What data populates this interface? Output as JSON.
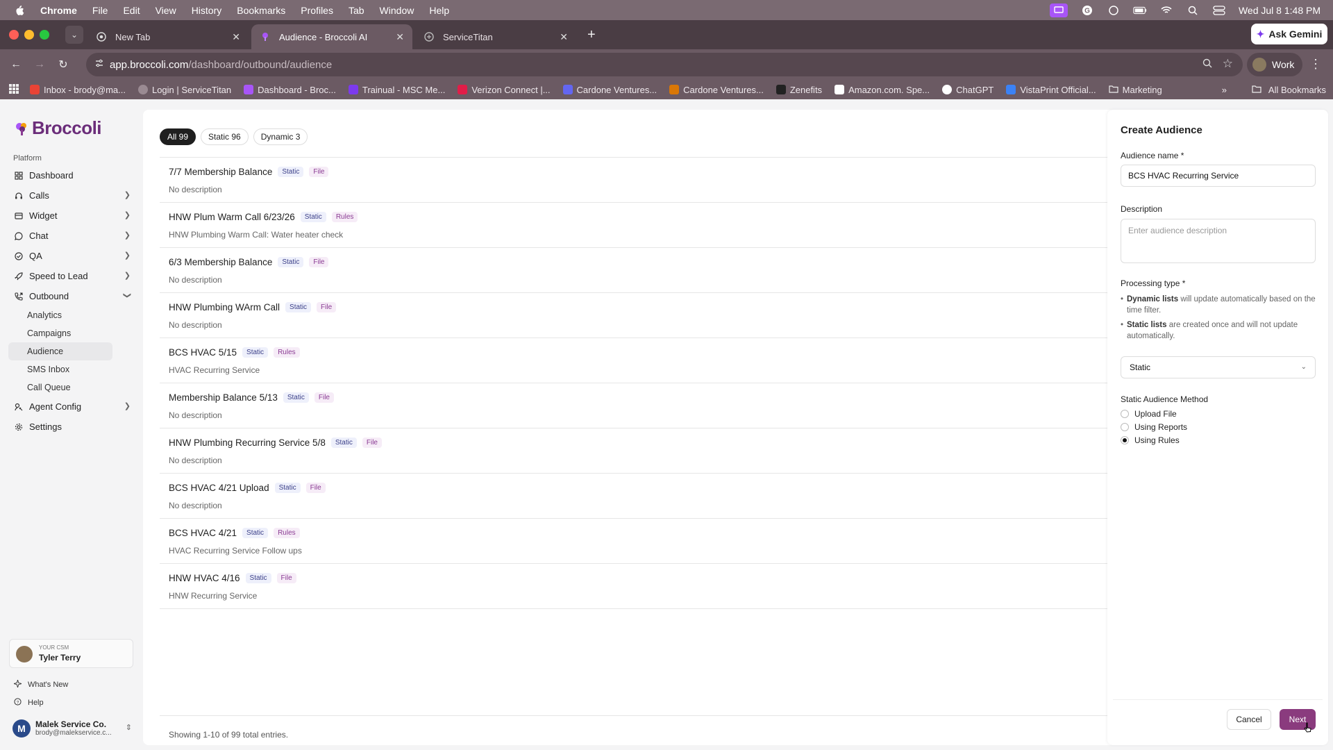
{
  "menubar": {
    "items": [
      "Chrome",
      "File",
      "Edit",
      "View",
      "History",
      "Bookmarks",
      "Profiles",
      "Tab",
      "Window",
      "Help"
    ],
    "datetime": "Wed Jul 8  1:48 PM"
  },
  "tabs": [
    {
      "label": "New Tab"
    },
    {
      "label": "Audience - Broccoli AI"
    },
    {
      "label": "ServiceTitan"
    }
  ],
  "gemini_label": "Ask Gemini",
  "address": {
    "domain": "app.broccoli.com",
    "path": "/dashboard/outbound/audience"
  },
  "profile_label": "Work",
  "bookmarks": [
    "Inbox - brody@ma...",
    "Login | ServiceTitan",
    "Dashboard - Broc...",
    "Trainual - MSC Me...",
    "Verizon Connect |...",
    "Cardone Ventures...",
    "Cardone Ventures...",
    "Zenefits",
    "Amazon.com. Spe...",
    "ChatGPT",
    "VistaPrint Official...",
    "Marketing"
  ],
  "all_bookmarks_label": "All Bookmarks",
  "sidebar": {
    "logo_text": "Broccoli",
    "section_label": "Platform",
    "items": [
      {
        "label": "Dashboard",
        "icon": "grid-icon",
        "chevron": false
      },
      {
        "label": "Calls",
        "icon": "headset-icon",
        "chevron": true
      },
      {
        "label": "Widget",
        "icon": "widget-icon",
        "chevron": true
      },
      {
        "label": "Chat",
        "icon": "chat-icon",
        "chevron": true
      },
      {
        "label": "QA",
        "icon": "shield-check-icon",
        "chevron": true
      },
      {
        "label": "Speed to Lead",
        "icon": "rocket-icon",
        "chevron": true
      },
      {
        "label": "Outbound",
        "icon": "phone-outgoing-icon",
        "chevron": true,
        "expanded": true
      }
    ],
    "sub_items": [
      "Analytics",
      "Campaigns",
      "Audience",
      "SMS Inbox",
      "Call Queue"
    ],
    "items_after": [
      {
        "label": "Agent Config",
        "icon": "agent-config-icon",
        "chevron": true
      },
      {
        "label": "Settings",
        "icon": "gear-icon",
        "chevron": false
      }
    ],
    "csm_label": "YOUR CSM",
    "csm_name": "Tyler Terry",
    "whats_new": "What's New",
    "help": "Help",
    "account_name": "Malek Service Co.",
    "account_email": "brody@malekservice.c..."
  },
  "filters": [
    {
      "label": "All 99",
      "active": true
    },
    {
      "label": "Static 96",
      "active": false
    },
    {
      "label": "Dynamic 3",
      "active": false
    }
  ],
  "audiences": [
    {
      "name": "7/7 Membership Balance",
      "type": "Static",
      "source": "File",
      "description": "No description"
    },
    {
      "name": "HNW Plum Warm Call 6/23/26",
      "type": "Static",
      "source": "Rules",
      "description": "HNW Plumbing Warm Call: Water heater check"
    },
    {
      "name": "6/3 Membership Balance",
      "type": "Static",
      "source": "File",
      "description": "No description"
    },
    {
      "name": "HNW Plumbing WArm Call",
      "type": "Static",
      "source": "File",
      "description": "No description"
    },
    {
      "name": "BCS HVAC 5/15",
      "type": "Static",
      "source": "Rules",
      "description": "HVAC Recurring Service"
    },
    {
      "name": "Membership Balance 5/13",
      "type": "Static",
      "source": "File",
      "description": "No description"
    },
    {
      "name": "HNW Plumbing Recurring Service 5/8",
      "type": "Static",
      "source": "File",
      "description": "No description"
    },
    {
      "name": "BCS HVAC 4/21 Upload",
      "type": "Static",
      "source": "File",
      "description": "No description"
    },
    {
      "name": "BCS HVAC 4/21",
      "type": "Static",
      "source": "Rules",
      "description": "HVAC Recurring Service Follow ups"
    },
    {
      "name": "HNW HVAC 4/16",
      "type": "Static",
      "source": "File",
      "description": "HNW Recurring Service"
    }
  ],
  "pagination_text": "Showing 1-10 of 99 total entries.",
  "panel": {
    "title": "Create Audience",
    "name_label": "Audience name *",
    "name_value": "BCS HVAC Recurring Service",
    "description_label": "Description",
    "description_placeholder": "Enter audience description",
    "processing_label": "Processing type *",
    "dynamic_bold": "Dynamic lists",
    "dynamic_rest": " will update automatically based on the time filter.",
    "static_bold": "Static lists",
    "static_rest": " are created once and will not update automatically.",
    "processing_value": "Static",
    "method_label": "Static Audience Method",
    "methods": [
      {
        "label": "Upload File",
        "selected": false
      },
      {
        "label": "Using Reports",
        "selected": false
      },
      {
        "label": "Using Rules",
        "selected": true
      }
    ],
    "cancel_label": "Cancel",
    "next_label": "Next"
  }
}
